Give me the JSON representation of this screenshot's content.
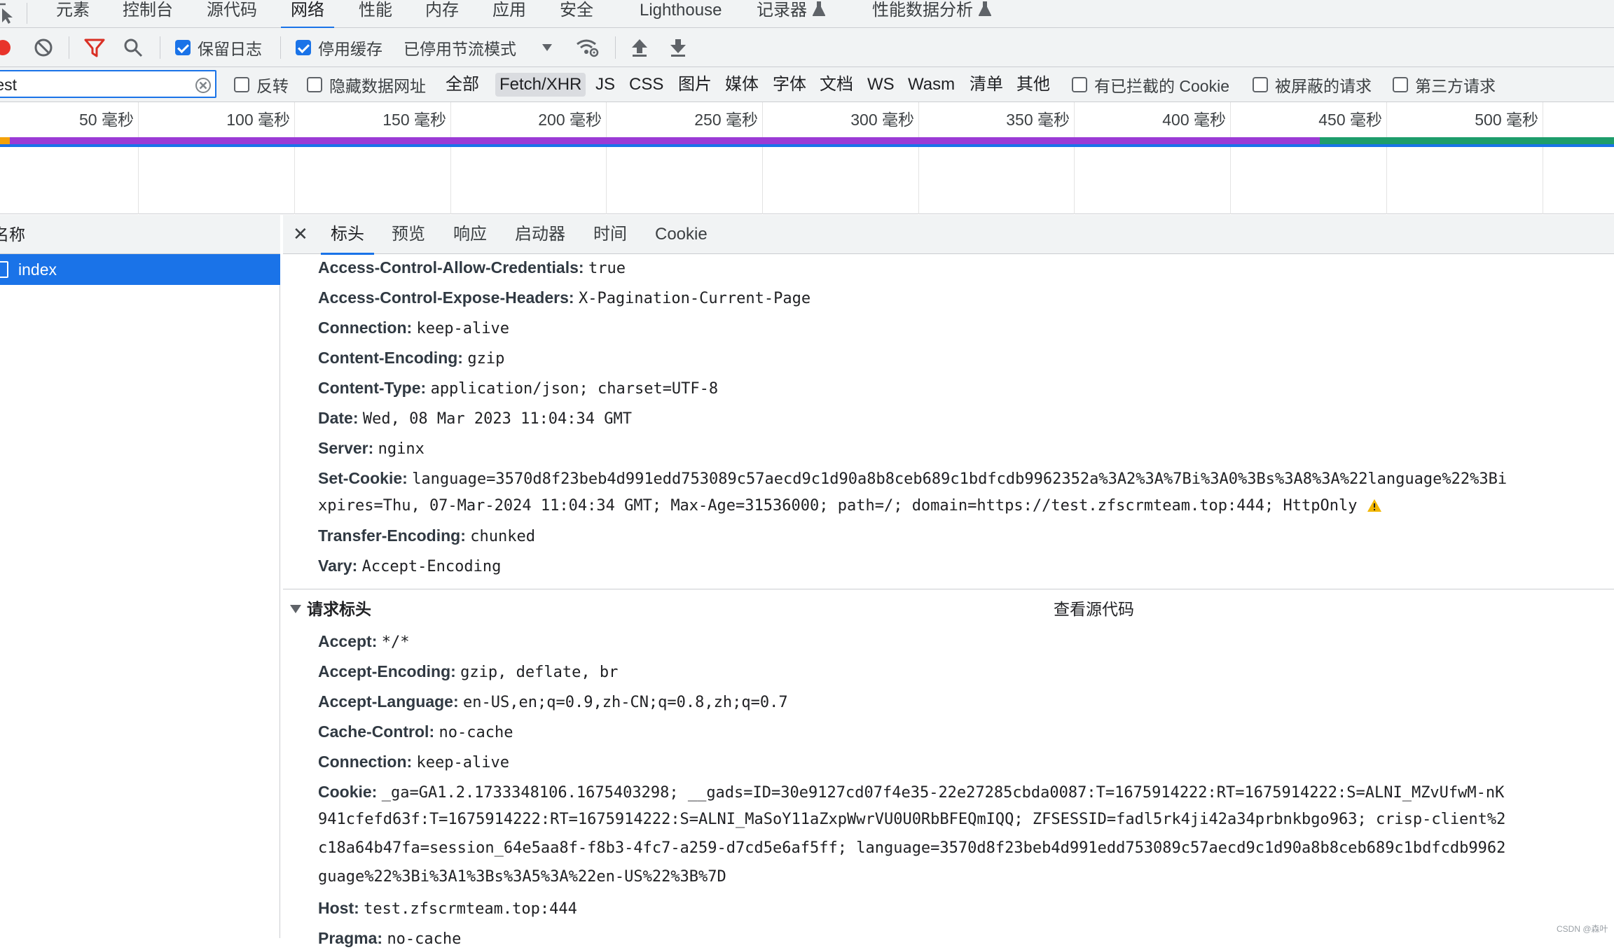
{
  "top_tabs": [
    "元素",
    "控制台",
    "源代码",
    "网络",
    "性能",
    "内存",
    "应用",
    "安全",
    "Lighthouse",
    "记录器",
    "性能数据分析"
  ],
  "toolbar": {
    "preserve_log_label": "保留日志",
    "preserve_log_checked": true,
    "disable_cache_label": "停用缓存",
    "disable_cache_checked": true,
    "throttling_value": "已停用节流模式"
  },
  "filter": {
    "value": "test",
    "invert_label": "反转",
    "hide_data_urls_label": "隐藏数据网址",
    "types": [
      "全部",
      "Fetch/XHR",
      "JS",
      "CSS",
      "图片",
      "媒体",
      "字体",
      "文档",
      "WS",
      "Wasm",
      "清单",
      "其他"
    ],
    "active_type": "Fetch/XHR",
    "blocked_cookies_label": "有已拦截的 Cookie",
    "blocked_requests_label": "被屏蔽的请求",
    "third_party_label": "第三方请求"
  },
  "timeline": {
    "ticks": [
      "50 毫秒",
      "100 毫秒",
      "150 毫秒",
      "200 毫秒",
      "250 毫秒",
      "300 毫秒",
      "350 毫秒",
      "400 毫秒",
      "450 毫秒",
      "500 毫秒"
    ],
    "colors": {
      "waiting": "#9b3bd5",
      "download": "#1e9d6b",
      "queue": "#f4a20a",
      "dom": "#1a73e8"
    }
  },
  "request_list": {
    "column_header": "名称",
    "selected_request": "index"
  },
  "detail_tabs": [
    "标头",
    "预览",
    "响应",
    "启动器",
    "时间",
    "Cookie"
  ],
  "response_headers": [
    {
      "name": "Access-Control-Allow-Credentials:",
      "value": "true"
    },
    {
      "name": "Access-Control-Expose-Headers:",
      "value": "X-Pagination-Current-Page"
    },
    {
      "name": "Connection:",
      "value": "keep-alive"
    },
    {
      "name": "Content-Encoding:",
      "value": "gzip"
    },
    {
      "name": "Content-Type:",
      "value": "application/json; charset=UTF-8"
    },
    {
      "name": "Date:",
      "value": "Wed, 08 Mar 2023 11:04:34 GMT"
    },
    {
      "name": "Server:",
      "value": "nginx"
    },
    {
      "name": "Set-Cookie:",
      "value": "language=3570d8f23beb4d991edd753089c57aecd9c1d90a8b8ceb689c1bdfcdb9962352a%3A2%3A%7Bi%3A0%3Bs%3A8%3A%22language%22%3Bi"
    }
  ],
  "set_cookie_continuation": "xpires=Thu, 07-Mar-2024 11:04:34 GMT; Max-Age=31536000; path=/; domain=https://test.zfscrmteam.top:444; HttpOnly",
  "response_headers_tail": [
    {
      "name": "Transfer-Encoding:",
      "value": "chunked"
    },
    {
      "name": "Vary:",
      "value": "Accept-Encoding"
    }
  ],
  "request_section": {
    "title": "请求标头",
    "view_source": "查看源代码"
  },
  "request_headers": [
    {
      "name": "Accept:",
      "value": "*/*"
    },
    {
      "name": "Accept-Encoding:",
      "value": "gzip, deflate, br"
    },
    {
      "name": "Accept-Language:",
      "value": "en-US,en;q=0.9,zh-CN;q=0.8,zh;q=0.7"
    },
    {
      "name": "Cache-Control:",
      "value": "no-cache"
    },
    {
      "name": "Connection:",
      "value": "keep-alive"
    },
    {
      "name": "Cookie:",
      "value": "_ga=GA1.2.1733348106.1675403298; __gads=ID=30e9127cd07f4e35-22e27285cbda0087:T=1675914222:RT=1675914222:S=ALNI_MZvUfwM-nK"
    }
  ],
  "cookie_continuations": [
    "941cfefd63f:T=1675914222:RT=1675914222:S=ALNI_MaSoY11aZxpWwrVU0U0RbBFEQmIQQ; ZFSESSID=fadl5rk4ji42a34prbnkbgo963; crisp-client%2",
    "c18a64b47fa=session_64e5aa8f-f8b3-4fc7-a259-d7cd5e6af5ff; language=3570d8f23beb4d991edd753089c57aecd9c1d90a8b8ceb689c1bdfcdb9962",
    "guage%22%3Bi%3A1%3Bs%3A5%3A%22en-US%22%3B%7D"
  ],
  "request_headers_tail": [
    {
      "name": "Host:",
      "value": "test.zfscrmteam.top:444"
    },
    {
      "name": "Pragma:",
      "value": "no-cache"
    }
  ],
  "watermark": "CSDN @森叶"
}
